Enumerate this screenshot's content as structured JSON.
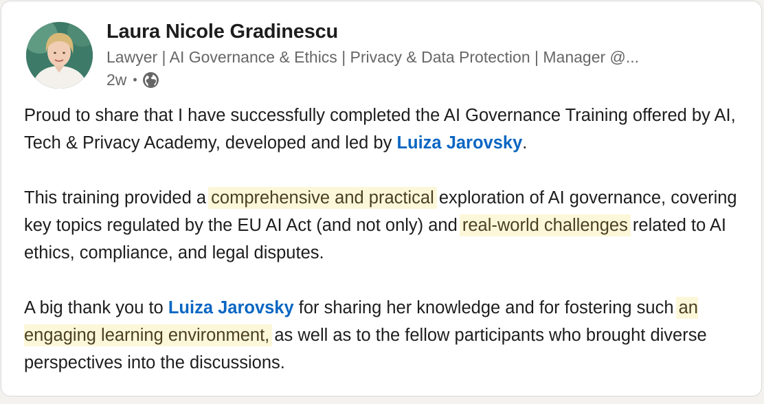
{
  "author": {
    "name": "Laura Nicole Gradinescu",
    "headline": "Lawyer | AI Governance & Ethics | Privacy & Data Protection | Manager @...",
    "time": "2w",
    "separator": "•",
    "visibility_icon": "globe-icon"
  },
  "post": {
    "p1": {
      "text1": "Proud to share that I have successfully completed the AI Governance Training offered by AI, Tech & Privacy Academy, developed and led by ",
      "mention": "Luiza Jarovsky",
      "text2": "."
    },
    "p2": {
      "text1": "This training provided a ",
      "highlight1": "comprehensive and practical",
      "text2": " exploration of AI governance, covering key topics regulated by the EU AI Act (and not only) and ",
      "highlight2": "real-world challenges",
      "text3": " related to AI ethics, compliance, and legal disputes."
    },
    "p3": {
      "text1": "A big thank you to ",
      "mention": "Luiza Jarovsky",
      "text2": " for sharing her knowledge and for fostering such ",
      "highlight": "an engaging learning environment,",
      "text3": " as well as to the fellow participants who brought diverse perspectives into the discussions."
    }
  },
  "colors": {
    "mention": "#0a66c2",
    "highlight_bg": "#fdf7d9",
    "text": "#1d1d1d",
    "muted": "#666666"
  }
}
